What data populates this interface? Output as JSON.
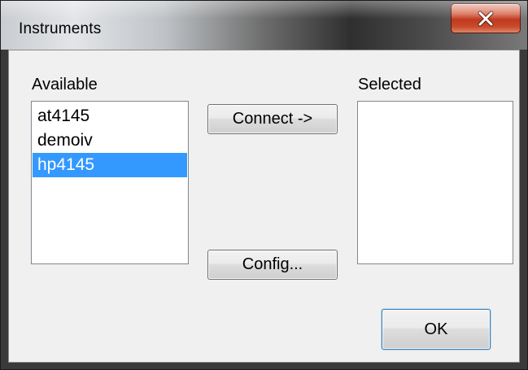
{
  "window": {
    "title": "Instruments"
  },
  "titlebar": {
    "close_icon": "close-icon"
  },
  "available": {
    "label": "Available",
    "items": [
      "at4145",
      "demoiv",
      "hp4145"
    ],
    "selected_item": "hp4145"
  },
  "selected": {
    "label": "Selected",
    "items": []
  },
  "buttons": {
    "connect": "Connect ->",
    "config": "Config...",
    "ok": "OK"
  },
  "colors": {
    "selection": "#3399ff",
    "close_button": "#c0391f",
    "dialog_bg": "#f0f0f0"
  }
}
